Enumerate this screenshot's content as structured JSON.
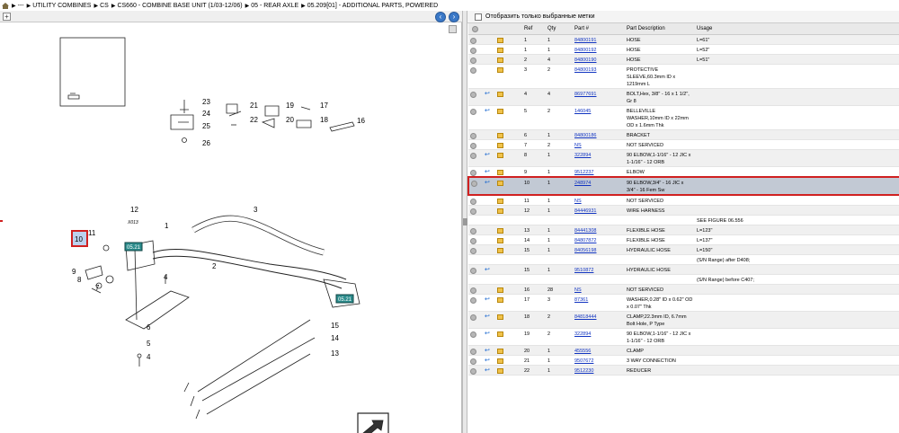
{
  "breadcrumb": {
    "segments": [
      "---",
      "UTILITY COMBINES",
      "CS",
      "CS660 - COMBINE BASE UNIT (1/03-12/06)",
      "05 - REAR AXLE",
      "05.209[01] - ADDITIONAL PARTS, POWERED"
    ]
  },
  "diagram": {
    "callouts": [
      "23",
      "24",
      "25",
      "26",
      "21",
      "22",
      "19",
      "20",
      "17",
      "18",
      "16",
      "12",
      "X013",
      "1",
      "3",
      "2",
      "11",
      "10",
      "9",
      "8",
      "7",
      "4",
      "6",
      "5",
      "4",
      "15",
      "14",
      "13"
    ],
    "link_badges": [
      "05.21",
      "05.21"
    ]
  },
  "filter": {
    "label": "Отобразить только выбранные метки"
  },
  "columns": [
    "Ref",
    "Qty",
    "Part #",
    "Part Description",
    "Usage"
  ],
  "rows": [
    {
      "ref": "1",
      "qty": "1",
      "part": "84800191",
      "desc": "HOSE",
      "usage": "L=61\"",
      "eng": true,
      "arrow": false,
      "link": true
    },
    {
      "ref": "1",
      "qty": "1",
      "part": "84800192",
      "desc": "HOSE",
      "usage": "L=52\"",
      "eng": true,
      "arrow": false,
      "link": true
    },
    {
      "ref": "2",
      "qty": "4",
      "part": "84800190",
      "desc": "HOSE",
      "usage": "L=51\"",
      "eng": true,
      "arrow": false,
      "link": true
    },
    {
      "ref": "3",
      "qty": "2",
      "part": "84800193",
      "desc": "PROTECTIVE SLEEVE,60.3mm ID x 1219mm L",
      "usage": "",
      "eng": true,
      "arrow": false,
      "link": true
    },
    {
      "ref": "4",
      "qty": "4",
      "part": "86977691",
      "desc": "BOLT,Hex, 3/8\" - 16 x 1 1/2\", Gr 8",
      "usage": "",
      "eng": true,
      "arrow": true,
      "link": true
    },
    {
      "ref": "5",
      "qty": "2",
      "part": "146045",
      "desc": "BELLEVILLE WASHER,10mm ID x 22mm OD x 1.6mm Thk",
      "usage": "",
      "eng": true,
      "arrow": true,
      "link": true
    },
    {
      "ref": "6",
      "qty": "1",
      "part": "84800186",
      "desc": "BRACKET",
      "usage": "",
      "eng": true,
      "arrow": false,
      "link": true
    },
    {
      "ref": "7",
      "qty": "2",
      "part": "NS",
      "desc": "NOT SERVICED",
      "usage": "",
      "eng": true,
      "arrow": false,
      "link": true
    },
    {
      "ref": "8",
      "qty": "1",
      "part": "322894",
      "desc": "90 ELBOW,1-1/16\" - 12 JIC x 1-1/16\" - 12 ORB",
      "usage": "",
      "eng": true,
      "arrow": true,
      "link": true
    },
    {
      "ref": "9",
      "qty": "1",
      "part": "9512237",
      "desc": "ELBOW",
      "usage": "",
      "eng": true,
      "arrow": true,
      "link": true
    },
    {
      "ref": "10",
      "qty": "1",
      "part": "248974",
      "desc": "90 ELBOW,3/4\" - 16 JIC x 3/4\" - 16 Fem Sw",
      "usage": "",
      "eng": true,
      "arrow": true,
      "link": true,
      "selected": true
    },
    {
      "ref": "11",
      "qty": "1",
      "part": "NS",
      "desc": "NOT SERVICED",
      "usage": "",
      "eng": true,
      "arrow": false,
      "link": true
    },
    {
      "ref": "12",
      "qty": "1",
      "part": "84446931",
      "desc": "WIRE HARNESS",
      "usage": "",
      "eng": true,
      "arrow": false,
      "link": true
    },
    {
      "ref": "",
      "qty": "",
      "part": "",
      "desc": "",
      "usage": "SEE FIGURE 06.556",
      "eng": false,
      "arrow": false,
      "link": false
    },
    {
      "ref": "13",
      "qty": "1",
      "part": "84441308",
      "desc": "FLEXIBLE HOSE",
      "usage": "L=123\"",
      "eng": true,
      "arrow": false,
      "link": true
    },
    {
      "ref": "14",
      "qty": "1",
      "part": "84807872",
      "desc": "FLEXIBLE HOSE",
      "usage": "L=137\"",
      "eng": true,
      "arrow": false,
      "link": true
    },
    {
      "ref": "15",
      "qty": "1",
      "part": "84056198",
      "desc": "HYDRAULIC HOSE",
      "usage": "L=150\"",
      "eng": true,
      "arrow": false,
      "link": true
    },
    {
      "ref": "",
      "qty": "",
      "part": "",
      "desc": "",
      "usage": "(S/N Range) after D408;",
      "eng": false,
      "arrow": false,
      "link": false
    },
    {
      "ref": "15",
      "qty": "1",
      "part": "9510872",
      "desc": "HYDRAULIC HOSE",
      "usage": "",
      "eng": false,
      "arrow": true,
      "link": true
    },
    {
      "ref": "",
      "qty": "",
      "part": "",
      "desc": "",
      "usage": "(S/N Range) before C407;",
      "eng": false,
      "arrow": false,
      "link": false
    },
    {
      "ref": "16",
      "qty": "28",
      "part": "NS",
      "desc": "NOT SERVICED",
      "usage": "",
      "eng": true,
      "arrow": false,
      "link": true
    },
    {
      "ref": "17",
      "qty": "3",
      "part": "87361",
      "desc": "WASHER,0.28\" ID x 0.62\" OD x 0.07\" Thk",
      "usage": "",
      "eng": true,
      "arrow": true,
      "link": true
    },
    {
      "ref": "18",
      "qty": "2",
      "part": "84818444",
      "desc": "CLAMP,22.3mm ID, 6.7mm Bolt Hole, P Type",
      "usage": "",
      "eng": true,
      "arrow": true,
      "link": true
    },
    {
      "ref": "19",
      "qty": "2",
      "part": "322894",
      "desc": "90 ELBOW,1-1/16\" - 12 JIC x 1-1/16\" - 12 ORB",
      "usage": "",
      "eng": true,
      "arrow": true,
      "link": true
    },
    {
      "ref": "20",
      "qty": "1",
      "part": "455556",
      "desc": "CLAMP",
      "usage": "",
      "eng": true,
      "arrow": true,
      "link": true
    },
    {
      "ref": "21",
      "qty": "1",
      "part": "9507672",
      "desc": "3 WAY CONNECTION",
      "usage": "",
      "eng": true,
      "arrow": true,
      "link": true
    },
    {
      "ref": "22",
      "qty": "1",
      "part": "9512230",
      "desc": "REDUCER",
      "usage": "",
      "eng": true,
      "arrow": true,
      "link": true
    }
  ],
  "colors": {
    "selection_border": "#d02020",
    "selection_bg": "#c2c9d4",
    "link": "#1033c0",
    "nav_button": "#3a78c7"
  },
  "icons": [
    "home-icon",
    "plus-icon",
    "back-arrow-icon",
    "forward-arrow-icon",
    "fit-icon",
    "info-circle-icon",
    "engine-icon",
    "return-arrow-icon"
  ]
}
